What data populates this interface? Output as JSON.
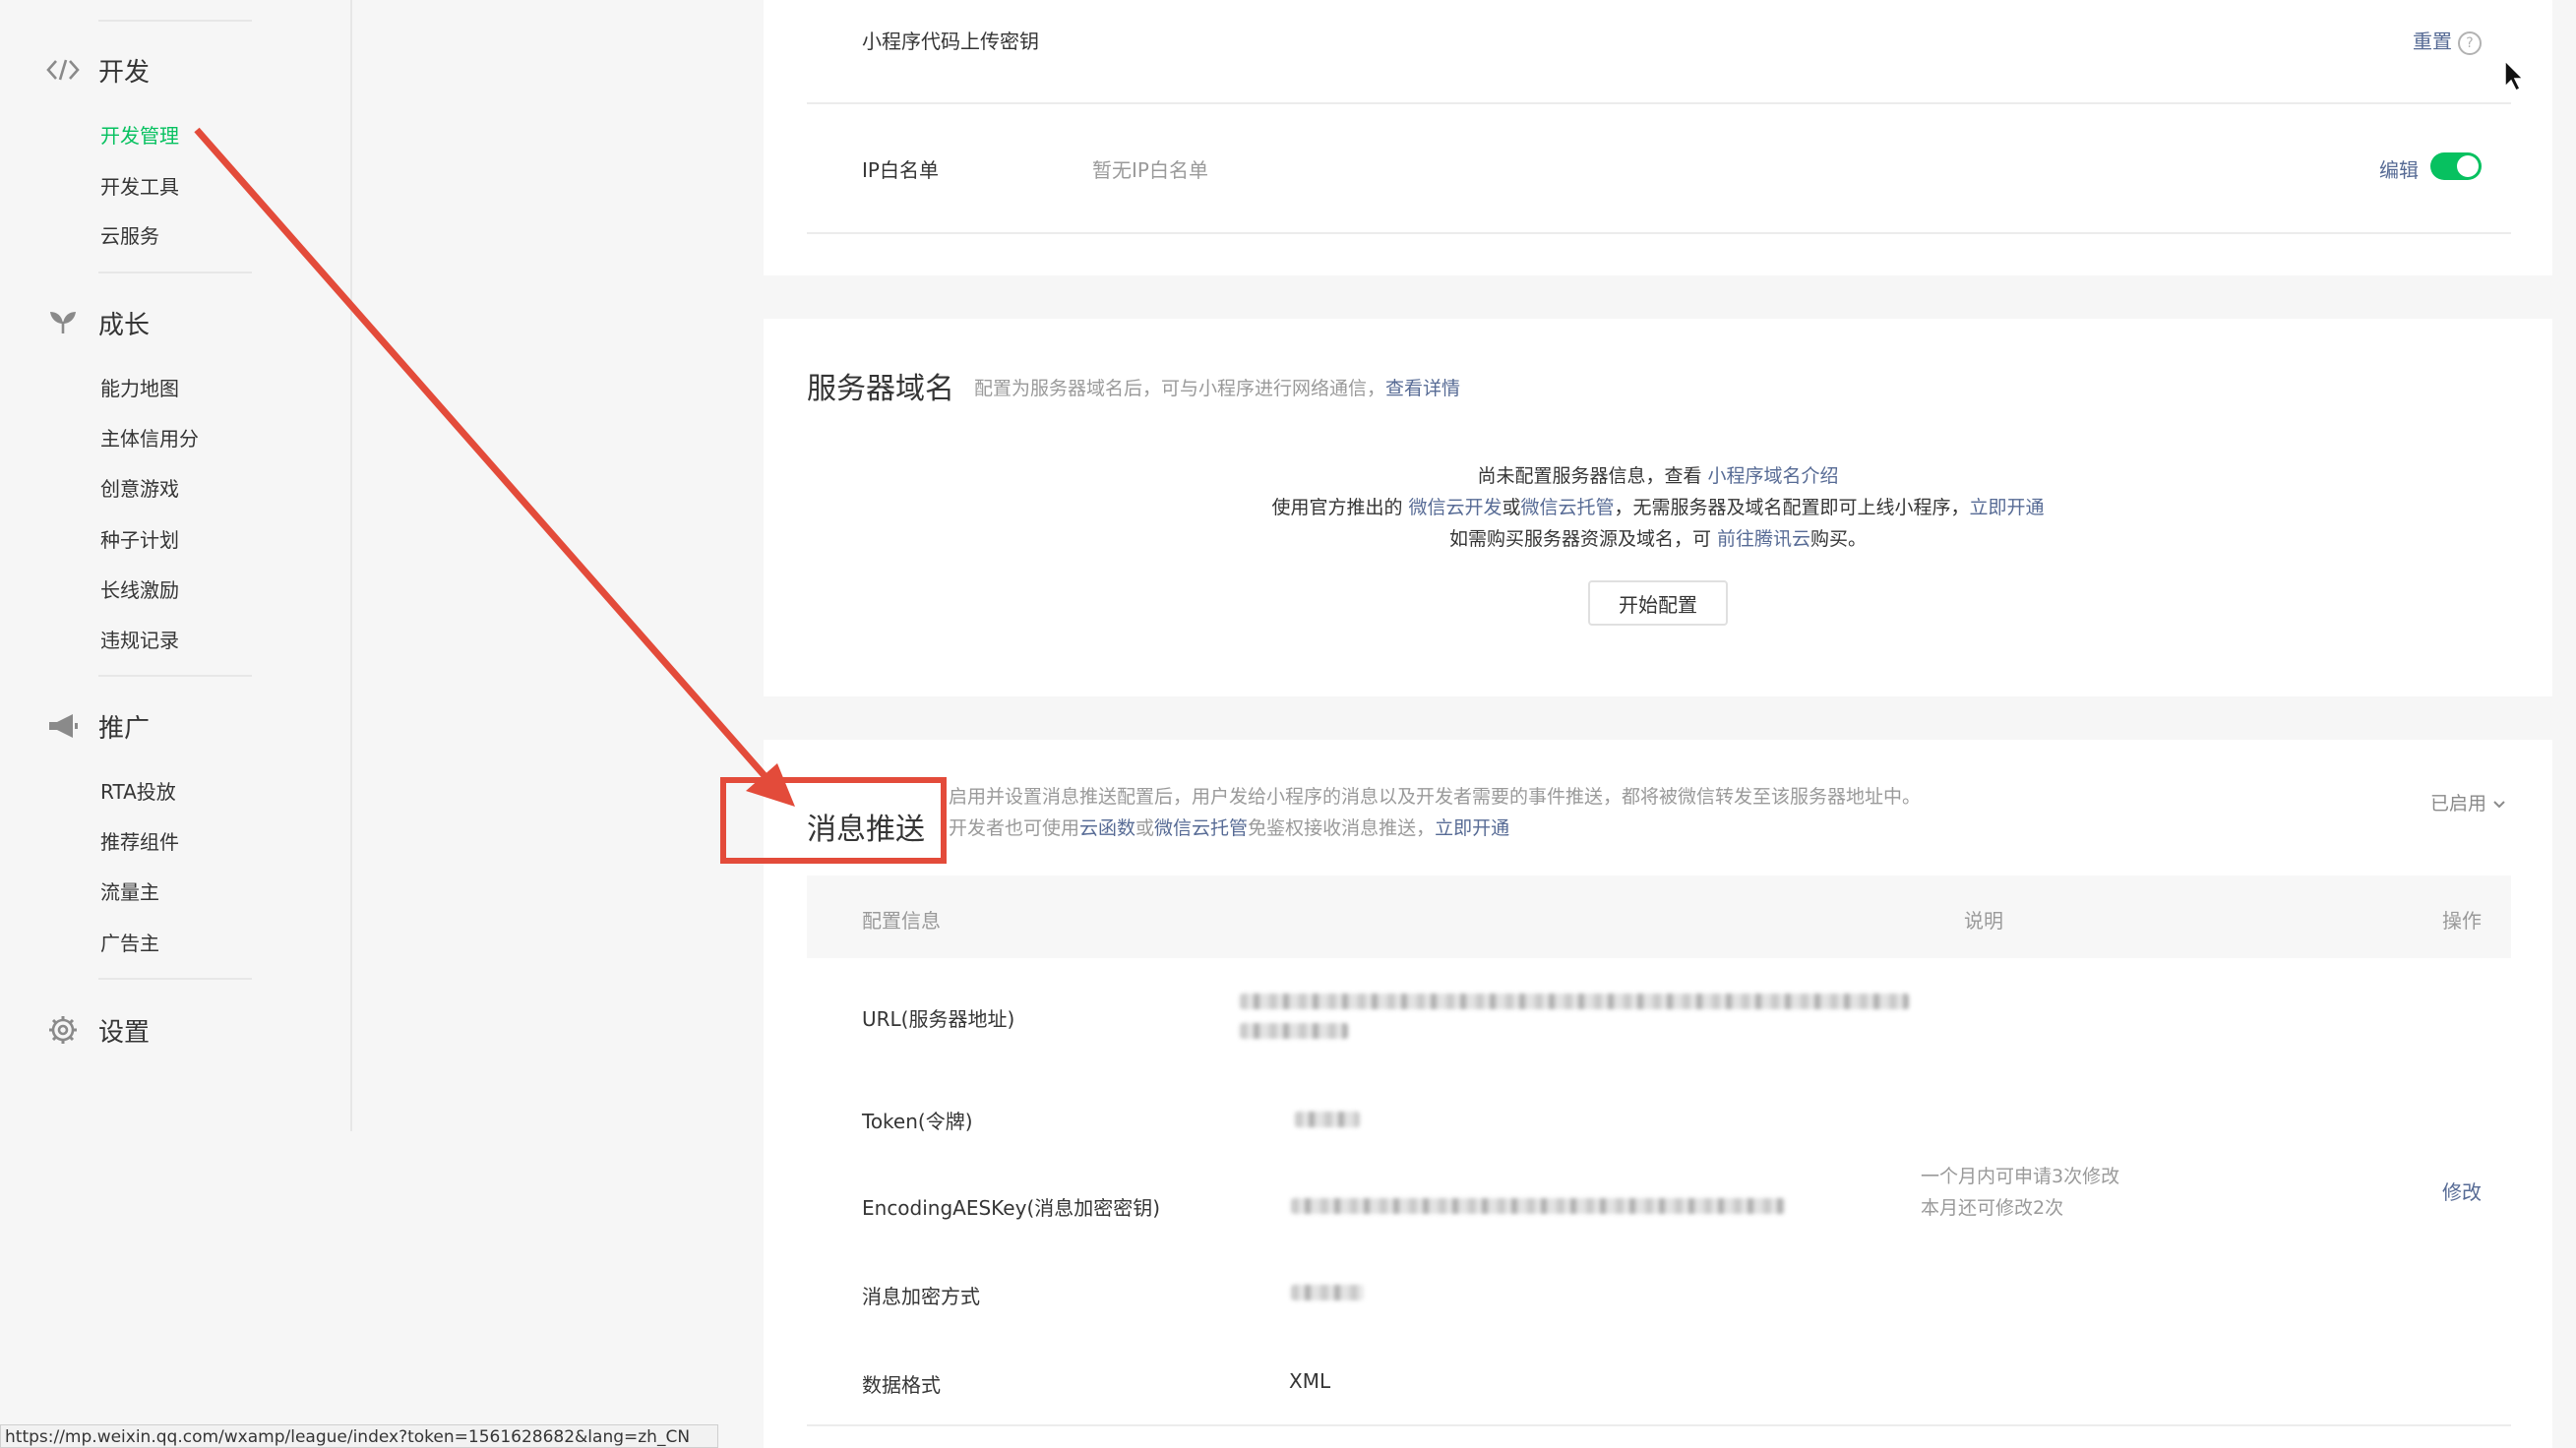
{
  "sidebar": {
    "groups": [
      {
        "label": "开发",
        "icon": "code-icon",
        "items": [
          "开发管理",
          "开发工具",
          "云服务"
        ]
      },
      {
        "label": "成长",
        "icon": "sprout-icon",
        "items": [
          "能力地图",
          "主体信用分",
          "创意游戏",
          "种子计划",
          "长线激励",
          "违规记录"
        ]
      },
      {
        "label": "推广",
        "icon": "megaphone-icon",
        "items": [
          "RTA投放",
          "推荐组件",
          "流量主",
          "广告主"
        ]
      },
      {
        "label": "设置",
        "icon": "gear-icon",
        "items": []
      }
    ],
    "active_item": "开发管理"
  },
  "card1": {
    "upload_key_label": "小程序代码上传密钥",
    "reset_label": "重置",
    "ip_label": "IP白名单",
    "ip_value": "暂无IP白名单",
    "edit_label": "编辑"
  },
  "card2": {
    "title": "服务器域名",
    "desc": "配置为服务器域名后，可与小程序进行网络通信，",
    "desc_link": "查看详情",
    "line1_pre": "尚未配置服务器信息，查看 ",
    "line1_link": "小程序域名介绍",
    "line2_pre": "使用官方推出的 ",
    "line2_link1": "微信云开发",
    "line2_mid1": "或",
    "line2_link2": "微信云托管",
    "line2_mid2": "，无需服务器及域名配置即可上线小程序，",
    "line2_link3": "立即开通",
    "line3_pre": "如需购买服务器资源及域名，可 ",
    "line3_link": "前往腾讯云",
    "line3_post": "购买。",
    "start_button": "开始配置"
  },
  "card3": {
    "title": "消息推送",
    "desc1": "启用并设置消息推送配置后，用户发给小程序的消息以及开发者需要的事件推送，都将被微信转发至该服务器地址中。",
    "desc2_pre": "开发者也可使用",
    "desc2_link1": "云函数",
    "desc2_mid": "或",
    "desc2_link2": "微信云托管",
    "desc2_post": "免鉴权接收消息推送，",
    "desc2_link3": "立即开通",
    "status": "已启用",
    "columns": [
      "配置信息",
      "说明",
      "操作"
    ],
    "rows": [
      {
        "label": "URL(服务器地址)"
      },
      {
        "label": "Token(令牌)"
      },
      {
        "label": "EncodingAESKey(消息加密密钥)",
        "note1": "一个月内可申请3次修改",
        "note2": "本月还可修改2次",
        "action": "修改"
      },
      {
        "label": "消息加密方式"
      },
      {
        "label": "数据格式",
        "value": "XML"
      }
    ]
  },
  "status_bar": "https://mp.weixin.qq.com/wxamp/league/index?token=1561628682&lang=zh_CN",
  "colors": {
    "accent": "#07c160",
    "link": "#576b95",
    "annotation": "#e34b3a"
  }
}
